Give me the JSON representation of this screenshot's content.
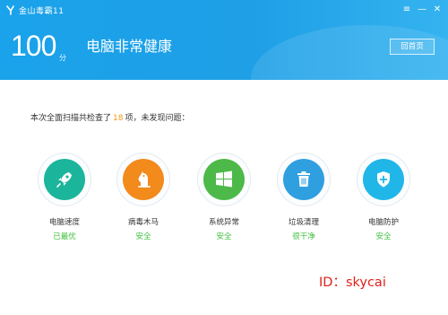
{
  "window": {
    "title": "金山毒霸11",
    "buttons": {
      "menu": "≡",
      "minimize": "—",
      "close": "✕"
    }
  },
  "header": {
    "score": "100",
    "score_unit": "分",
    "status": "电脑非常健康",
    "back_button": "回首页"
  },
  "summary": {
    "prefix": "本次全面扫描共检查了",
    "count": "18",
    "suffix": "项，未发现问题："
  },
  "items": [
    {
      "label": "电脑速度",
      "state": "已最优",
      "icon": "rocket-icon",
      "color": "#1bb59b"
    },
    {
      "label": "病毒木马",
      "state": "安全",
      "icon": "horse-icon",
      "color": "#f28a1c"
    },
    {
      "label": "系统异常",
      "state": "安全",
      "icon": "windows-icon",
      "color": "#4cb948"
    },
    {
      "label": "垃圾清理",
      "state": "很干净",
      "icon": "trash-icon",
      "color": "#2f9fe0"
    },
    {
      "label": "电脑防护",
      "state": "安全",
      "icon": "shield-icon",
      "color": "#21b6e8"
    }
  ],
  "watermark": "ID：skycai"
}
